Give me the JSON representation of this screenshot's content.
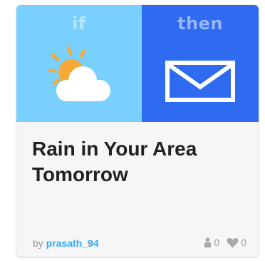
{
  "applet": {
    "trigger_label": "if",
    "action_label": "then",
    "trigger_icon": "partly-cloudy-icon",
    "action_icon": "email-icon",
    "title_line1": "Rain in Your Area",
    "title_line2": "Tomorrow",
    "by_prefix": "by",
    "author": "prasath_94",
    "users_count": "0",
    "favorites_count": "0"
  },
  "colors": {
    "trigger_bg": "#7ad0fc",
    "action_bg": "#2e6bf1",
    "author_link": "#33aaff",
    "sun": "#f7a935"
  }
}
